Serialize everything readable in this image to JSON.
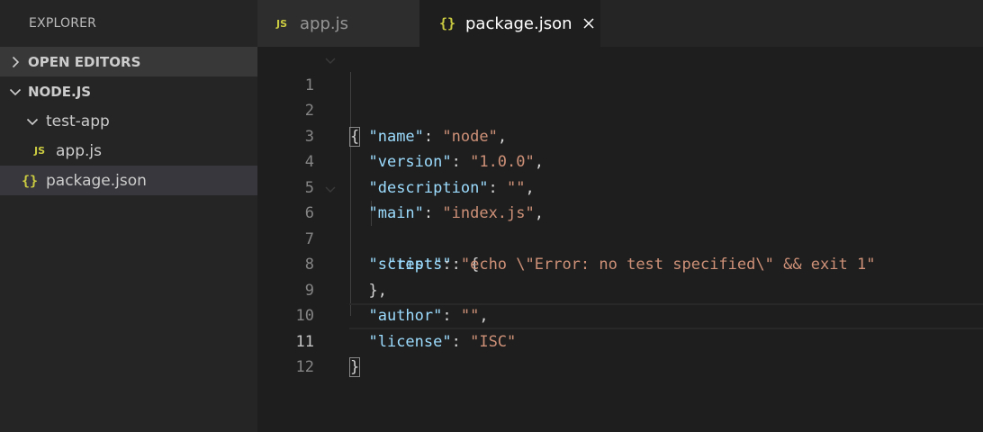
{
  "sidebar": {
    "title": "EXPLORER",
    "sections": {
      "open_editors": "OPEN EDITORS",
      "workspace": "NODE.JS"
    },
    "tree": {
      "folder": "test-app",
      "files": [
        "app.js",
        "package.json"
      ]
    }
  },
  "tabs": [
    {
      "label": "app.js",
      "icon": "js-icon"
    },
    {
      "label": "package.json",
      "icon": "json-braces-icon"
    }
  ],
  "icons": {
    "js": "JS",
    "json": "{}"
  },
  "editor": {
    "line_numbers": [
      "1",
      "2",
      "3",
      "4",
      "5",
      "6",
      "7",
      "8",
      "9",
      "10",
      "11",
      "12"
    ],
    "code": {
      "l1": "{",
      "name_key": "\"name\"",
      "name_val": "\"node\"",
      "version_key": "\"version\"",
      "version_val": "\"1.0.0\"",
      "description_key": "\"description\"",
      "description_val": "\"\"",
      "main_key": "\"main\"",
      "main_val": "\"index.js\"",
      "scripts_key": "\"scripts\"",
      "test_key": "\"test\"",
      "test_val": "\"echo \\\"Error: no test specified\\\" && exit 1\"",
      "author_key": "\"author\"",
      "author_val": "\"\"",
      "license_key": "\"license\"",
      "license_val": "\"ISC\"",
      "l11": "}"
    }
  },
  "colors": {
    "key": "#9cdcfe",
    "string": "#ce9178",
    "js_icon": "#cbcb41"
  }
}
